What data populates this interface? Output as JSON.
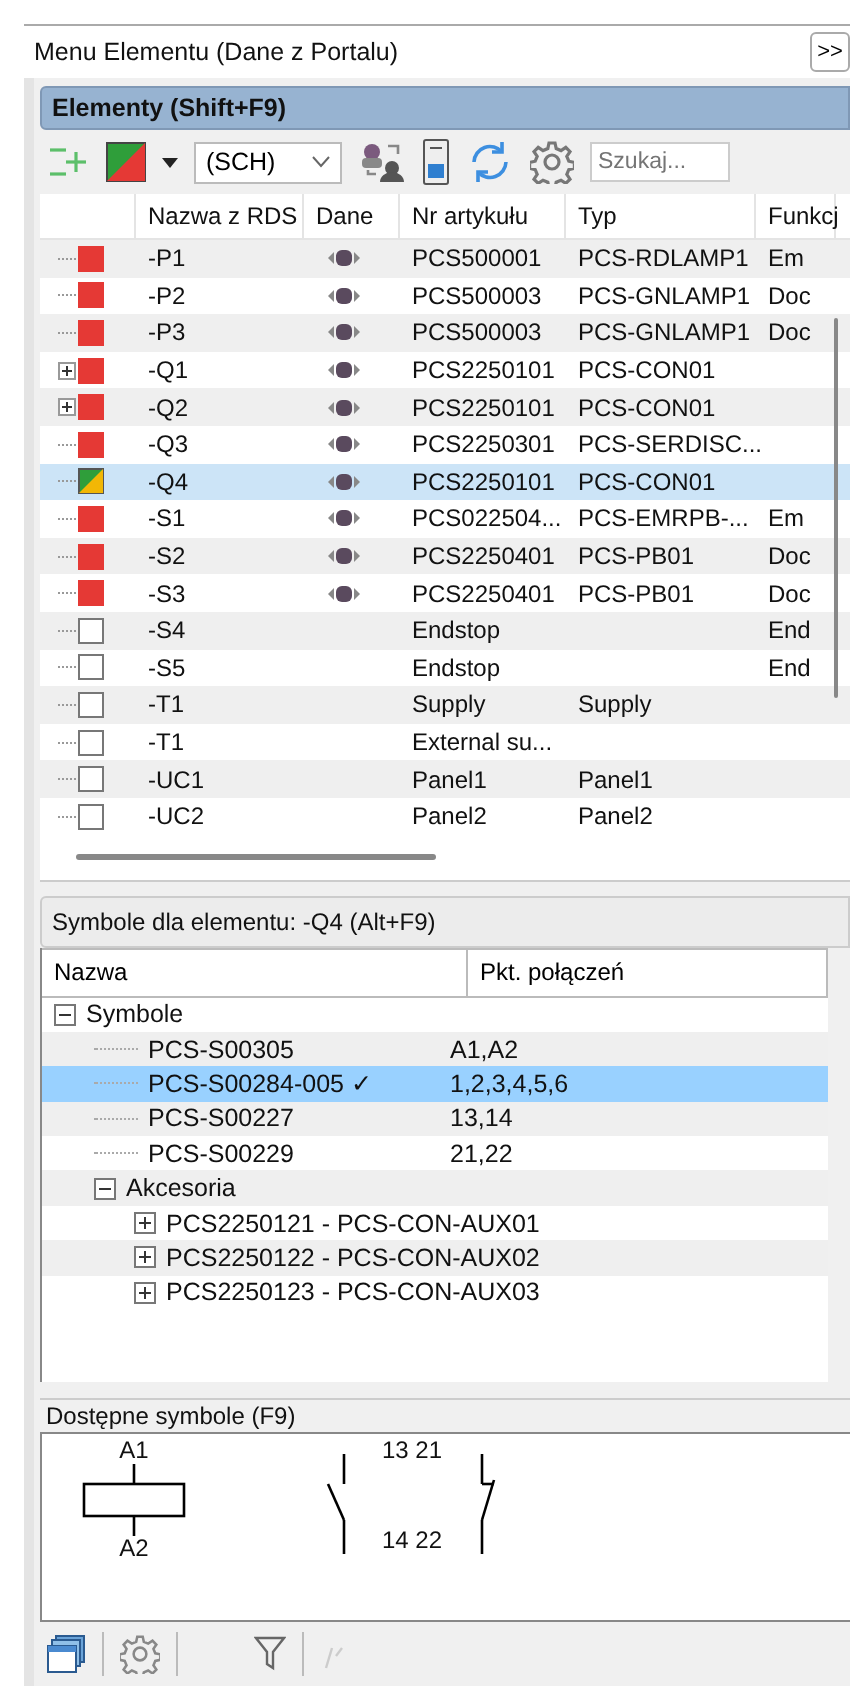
{
  "panel_title": "Menu Elementu (Dane z Portalu)",
  "expand_button": ">>",
  "elements": {
    "title": "Elementy (Shift+F9)",
    "filter": {
      "value": "(SCH)"
    },
    "search": {
      "placeholder": "Szukaj..."
    },
    "columns": [
      "Nazwa z RDS",
      "Dane",
      "Nr artykułu",
      "Typ",
      "Funkcj"
    ],
    "rows": [
      {
        "kind": "red",
        "expandable": false,
        "has_data": true,
        "name": "-P1",
        "article": "PCS500001",
        "type": "PCS-RDLAMP1",
        "function": "Em",
        "selected": false
      },
      {
        "kind": "red",
        "expandable": false,
        "has_data": true,
        "name": "-P2",
        "article": "PCS500003",
        "type": "PCS-GNLAMP1",
        "function": "Doc",
        "selected": false
      },
      {
        "kind": "red",
        "expandable": false,
        "has_data": true,
        "name": "-P3",
        "article": "PCS500003",
        "type": "PCS-GNLAMP1",
        "function": "Doc",
        "selected": false
      },
      {
        "kind": "red",
        "expandable": true,
        "has_data": true,
        "name": "-Q1",
        "article": "PCS2250101",
        "type": "PCS-CON01",
        "selected": false
      },
      {
        "kind": "red",
        "expandable": true,
        "has_data": true,
        "name": "-Q2",
        "article": "PCS2250101",
        "type": "PCS-CON01",
        "selected": false
      },
      {
        "kind": "red",
        "expandable": false,
        "has_data": true,
        "name": "-Q3",
        "article": "PCS2250301",
        "type": "PCS-SERDISC...",
        "selected": false
      },
      {
        "kind": "split",
        "expandable": false,
        "has_data": true,
        "name": "-Q4",
        "article": "PCS2250101",
        "type": "PCS-CON01",
        "selected": true
      },
      {
        "kind": "red",
        "expandable": false,
        "has_data": true,
        "name": "-S1",
        "article": "PCS022504...",
        "type": "PCS-EMRPB-...",
        "function": "Em",
        "selected": false
      },
      {
        "kind": "red",
        "expandable": false,
        "has_data": true,
        "name": "-S2",
        "article": "PCS2250401",
        "type": "PCS-PB01",
        "function": "Doc",
        "selected": false
      },
      {
        "kind": "red",
        "expandable": false,
        "has_data": true,
        "name": "-S3",
        "article": "PCS2250401",
        "type": "PCS-PB01",
        "function": "Doc",
        "selected": false
      },
      {
        "kind": "empty",
        "expandable": false,
        "has_data": false,
        "name": "-S4",
        "article": "Endstop",
        "function": "End",
        "selected": false
      },
      {
        "kind": "empty",
        "expandable": false,
        "has_data": false,
        "name": "-S5",
        "article": "Endstop",
        "function": "End",
        "selected": false
      },
      {
        "kind": "empty",
        "expandable": false,
        "has_data": false,
        "name": "-T1",
        "article": "Supply",
        "type": "Supply",
        "selected": false
      },
      {
        "kind": "empty",
        "expandable": false,
        "has_data": false,
        "name": "-T1",
        "article": "External su...",
        "selected": false
      },
      {
        "kind": "empty",
        "expandable": false,
        "has_data": false,
        "name": "-UC1",
        "article": "Panel1",
        "type": "Panel1",
        "selected": false
      },
      {
        "kind": "empty",
        "expandable": false,
        "has_data": false,
        "name": "-UC2",
        "article": "Panel2",
        "type": "Panel2",
        "selected": false
      }
    ]
  },
  "symbols": {
    "title": "Symbole dla elementu:  -Q4 (Alt+F9)",
    "columns": [
      "Nazwa",
      "Pkt. połączeń"
    ],
    "tree": [
      {
        "label": "Symbole",
        "expanded": true,
        "selected": false,
        "children": [
          {
            "label": "PCS-S00305",
            "points": "A1,A2",
            "selected": false
          },
          {
            "label": "PCS-S00284-005 ✓",
            "points": "1,2,3,4,5,6",
            "selected": true
          },
          {
            "label": "PCS-S00227",
            "points": "13,14",
            "selected": false
          },
          {
            "label": "PCS-S00229",
            "points": "21,22",
            "selected": false
          },
          {
            "label": "Akcesoria",
            "expanded": true,
            "selected": false,
            "children": [
              {
                "label": "PCS2250121 - PCS-CON-AUX01",
                "expanded": false,
                "selected": false
              },
              {
                "label": "PCS2250122 - PCS-CON-AUX02",
                "expanded": false,
                "selected": false
              },
              {
                "label": "PCS2250123 - PCS-CON-AUX03",
                "expanded": false,
                "selected": false
              }
            ]
          }
        ]
      }
    ]
  },
  "available": {
    "title": "Dostępne symbole (F9)",
    "coil_top": "A1",
    "coil_bottom": "A2",
    "contacts_top": "13 21",
    "contacts_bottom": "14 22"
  }
}
